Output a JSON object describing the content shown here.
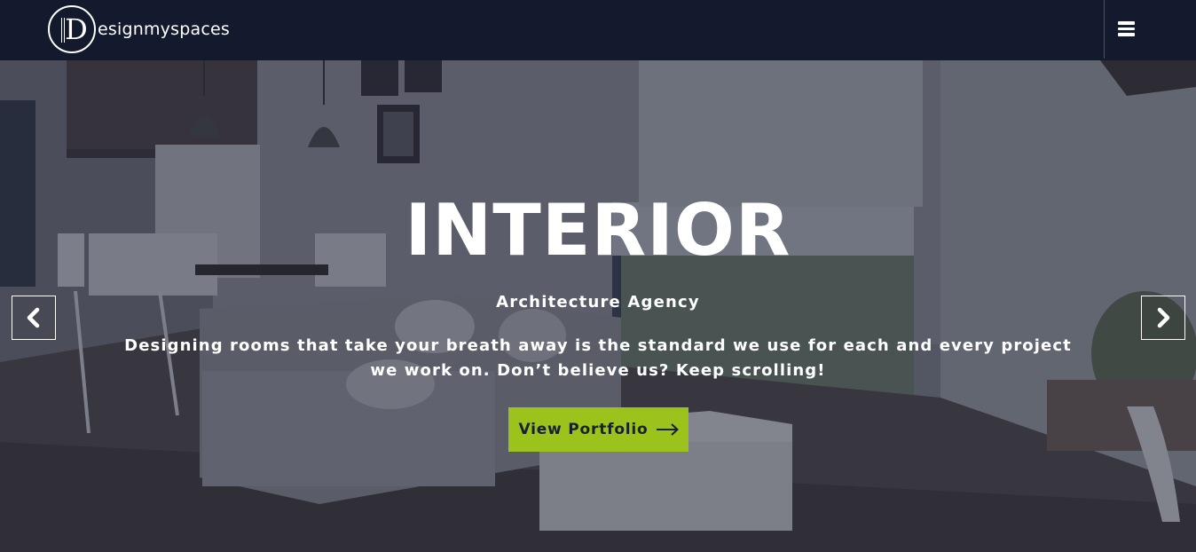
{
  "header": {
    "logo_text": "esignmyspaces",
    "logo_mark": "D",
    "menu_icon": "hamburger-menu-icon"
  },
  "hero": {
    "title": "INTERIOR",
    "subtitle": "Architecture Agency",
    "description": "Designing rooms that take your breath away is the standard we use for each and every project we work on. Don’t believe us? Keep scrolling!",
    "cta_label": "View Portfolio",
    "cta_icon": "long-arrow-right-icon",
    "prev_icon": "chevron-left-icon",
    "next_icon": "chevron-right-icon"
  },
  "colors": {
    "header_bg": "#131a2e",
    "accent": "#9bc31c",
    "text_light": "#ffffff"
  }
}
